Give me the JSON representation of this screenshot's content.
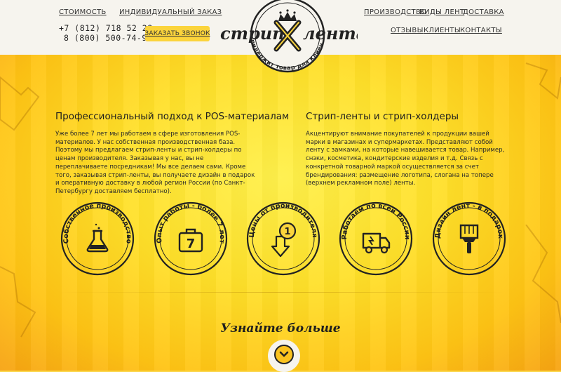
{
  "header": {
    "nav_left": [
      "Стоимость",
      "Индивидуальный заказ"
    ],
    "nav_right_top": [
      "Производство",
      "Виды лент",
      "Доставка"
    ],
    "nav_right_bottom": [
      "Отзывы",
      "Клиенты",
      "Контакты"
    ],
    "phones": [
      "+7 (812) 718 52 28",
      "8 (800) 500-74-97"
    ],
    "callback_label": "Заказать звонок"
  },
  "logo": {
    "left_word": "стрип",
    "right_word": "лента",
    "tagline": "придержит товар для клиента"
  },
  "columns": [
    {
      "title": "Профессиональный подход к POS-материалам",
      "text": "Уже более 7 лет мы работаем в сфере изготовления POS-материалов. У нас собственная производственная база. Поэтому мы предлагаем стрип-ленты и стрип-холдеры по ценам производителя. Заказывая у нас, вы не переплачиваете посредникам! Мы все делаем сами. Кроме того, заказывая стрип-ленты, вы получаете дизайн в подарок и оперативную доставку в любой регион России (по Санкт-Петербургу доставляем бесплатно)."
    },
    {
      "title": "Стрип-ленты и стрип-холдеры",
      "text": "Акцентируют внимание покупателей к продукции вашей марки в магазинах и супермаркетах. Представляют собой ленту с замками, на которые навешивается товар. Например, снэки, косметика, кондитерские изделия и т.д. Связь с конкретной товарной маркой осуществляется за счет брендирования: размещение логотипа, слогана на топере (верхнем рекламном поле) ленты."
    }
  ],
  "badges": [
    {
      "label": "Собственное производство",
      "icon": "flask-icon"
    },
    {
      "label": "Опыт работы - более 7 лет",
      "icon": "briefcase-icon",
      "number": "7"
    },
    {
      "label": "Цены от производителя",
      "icon": "coin-arrow-icon",
      "number": "1"
    },
    {
      "label": "Работаем по всей России",
      "icon": "truck-icon"
    },
    {
      "label": "Дизайн лент - в подарок",
      "icon": "paintbrush-icon"
    }
  ],
  "learn_more": "Узнайте больше",
  "colors": {
    "accent": "#fbd43c",
    "background": "#ffe02a",
    "header": "#f6f4ee",
    "dark": "#1e1e1e"
  }
}
